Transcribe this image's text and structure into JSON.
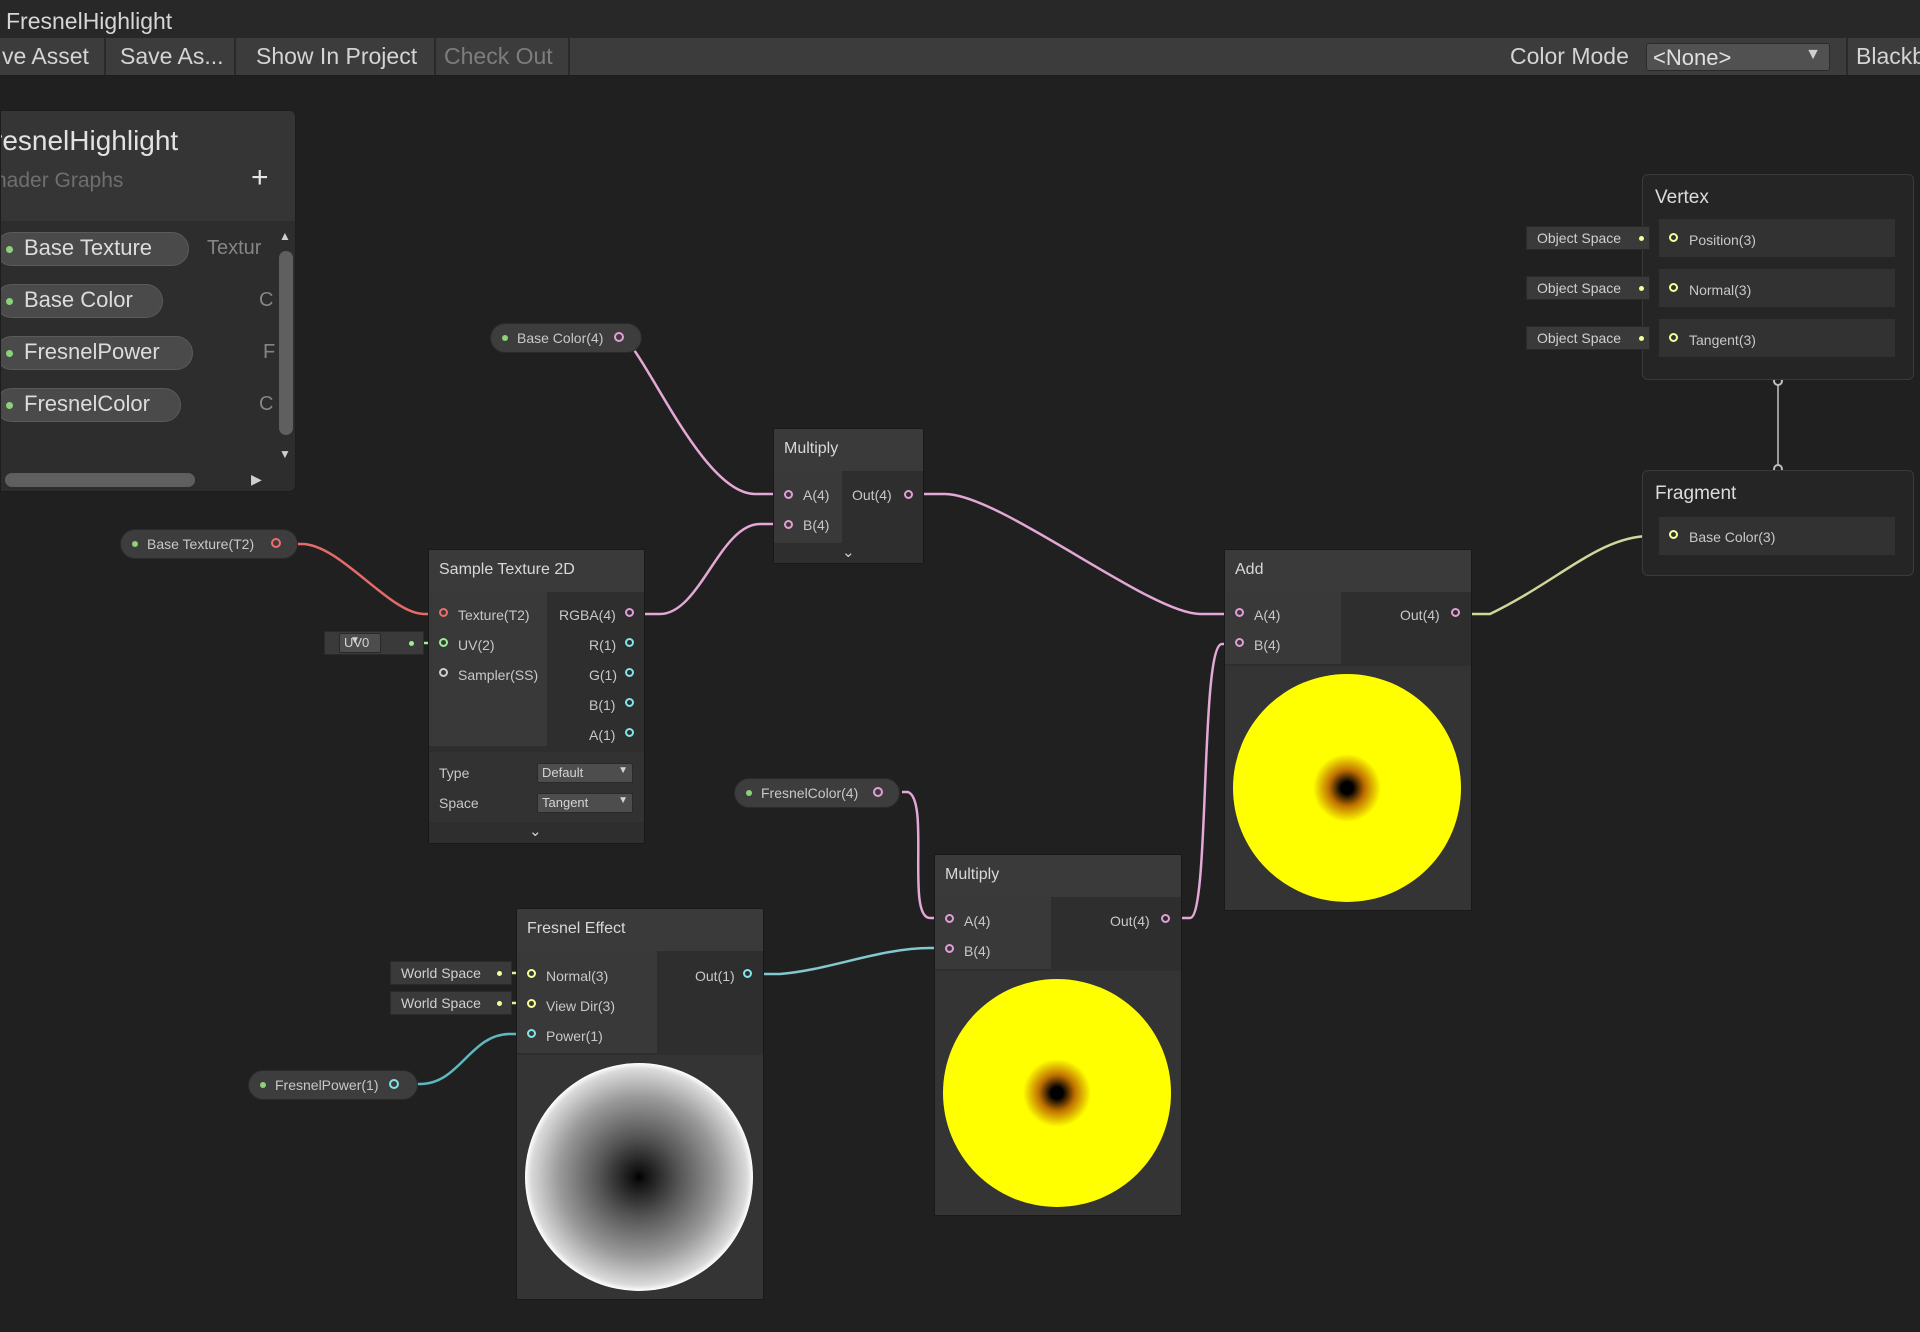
{
  "window": {
    "title": "FresnelHighlight"
  },
  "toolbar": {
    "save_asset": "ve Asset",
    "save_as": "Save As...",
    "show_in_project": "Show In Project",
    "check_out": "Check Out",
    "color_mode_label": "Color Mode",
    "color_mode_value": "<None>",
    "blackboard": "Blackb"
  },
  "blackboard": {
    "title": "resnelHighlight",
    "subtitle": "hader Graphs",
    "add_symbol": "+",
    "properties": [
      {
        "label": "Base Texture",
        "type": "Textur"
      },
      {
        "label": "Base Color",
        "type": "C"
      },
      {
        "label": "FresnelPower",
        "type": "F"
      },
      {
        "label": "FresnelColor",
        "type": "C"
      }
    ]
  },
  "property_nodes": {
    "base_color": "Base Color(4)",
    "base_texture": "Base Texture(T2)",
    "fresnel_color": "FresnelColor(4)",
    "fresnel_power": "FresnelPower(1)"
  },
  "nodes": {
    "multiply_top": {
      "title": "Multiply",
      "in_a": "A(4)",
      "in_b": "B(4)",
      "out": "Out(4)"
    },
    "sample_texture": {
      "title": "Sample Texture 2D",
      "in_texture": "Texture(T2)",
      "in_uv": "UV(2)",
      "in_sampler": "Sampler(SS)",
      "out_rgba": "RGBA(4)",
      "out_r": "R(1)",
      "out_g": "G(1)",
      "out_b": "B(1)",
      "out_a": "A(1)",
      "type_label": "Type",
      "type_value": "Default",
      "space_label": "Space",
      "space_value": "Tangent",
      "uv_chip": "UV0"
    },
    "add": {
      "title": "Add",
      "in_a": "A(4)",
      "in_b": "B(4)",
      "out": "Out(4)"
    },
    "multiply_bottom": {
      "title": "Multiply",
      "in_a": "A(4)",
      "in_b": "B(4)",
      "out": "Out(4)"
    },
    "fresnel": {
      "title": "Fresnel Effect",
      "in_normal": "Normal(3)",
      "in_viewdir": "View Dir(3)",
      "in_power": "Power(1)",
      "out": "Out(1)",
      "chip_normal": "World Space",
      "chip_viewdir": "World Space"
    },
    "vertex": {
      "title": "Vertex",
      "position": "Position(3)",
      "normal": "Normal(3)",
      "tangent": "Tangent(3)",
      "chip_position": "Object Space",
      "chip_normal": "Object Space",
      "chip_tangent": "Object Space"
    },
    "fragment": {
      "title": "Fragment",
      "base_color": "Base Color(3)"
    }
  },
  "colors": {
    "background": "#202020",
    "vector4_port": "#e39ed6",
    "texture_port": "#ee6c6c",
    "vector3_port": "#f6ff9a",
    "vector1_port": "#84e4e7",
    "vector2_port": "#9aef92",
    "property_dot": "#8fd07a",
    "preview_yellow": "#ffff00"
  }
}
